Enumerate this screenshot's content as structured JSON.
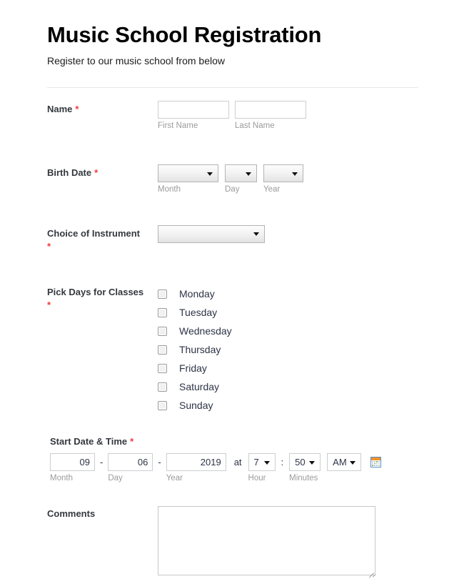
{
  "header": {
    "title": "Music School Registration",
    "subtitle": "Register to our music school from below"
  },
  "accent": {
    "required_color": "#f23a3c",
    "label_color": "#34383e",
    "sublabel_color": "#9b9b9b"
  },
  "fields": {
    "name": {
      "label": "Name",
      "required_mark": "*",
      "first": {
        "value": "",
        "placeholder": "",
        "sublabel": "First Name"
      },
      "last": {
        "value": "",
        "placeholder": "",
        "sublabel": "Last Name"
      }
    },
    "birth_date": {
      "label": "Birth Date",
      "required_mark": "*",
      "month": {
        "value": "",
        "sublabel": "Month"
      },
      "day": {
        "value": "",
        "sublabel": "Day"
      },
      "year": {
        "value": "",
        "sublabel": "Year"
      }
    },
    "instrument": {
      "label": "Choice of Instrument",
      "required_mark": "*",
      "value": ""
    },
    "days": {
      "label": "Pick Days for Classes",
      "required_mark": "*",
      "options": [
        {
          "label": "Monday",
          "checked": false
        },
        {
          "label": "Tuesday",
          "checked": false
        },
        {
          "label": "Wednesday",
          "checked": false
        },
        {
          "label": "Thursday",
          "checked": false
        },
        {
          "label": "Friday",
          "checked": false
        },
        {
          "label": "Saturday",
          "checked": false
        },
        {
          "label": "Sunday",
          "checked": false
        }
      ]
    },
    "start_datetime": {
      "label": "Start Date & Time",
      "required_mark": "*",
      "month": {
        "value": "09",
        "sublabel": "Month"
      },
      "day": {
        "value": "06",
        "sublabel": "Day"
      },
      "year": {
        "value": "2019",
        "sublabel": "Year"
      },
      "separator_dash": "-",
      "separator_at": "at",
      "separator_colon": ":",
      "hour": {
        "value": "7",
        "sublabel": "Hour"
      },
      "minutes": {
        "value": "50",
        "sublabel": "Minutes"
      },
      "ampm": {
        "value": "AM"
      },
      "calendar_icon": "calendar-icon"
    },
    "comments": {
      "label": "Comments",
      "value": "",
      "placeholder": ""
    }
  }
}
